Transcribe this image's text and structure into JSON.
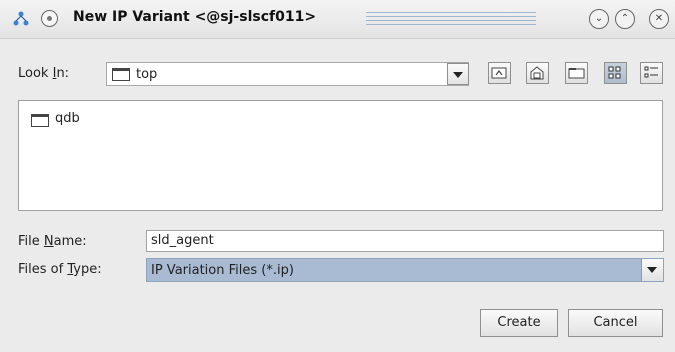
{
  "window": {
    "title": "New IP Variant <@sj-slscf011>",
    "controls": [
      "minimize-icon",
      "maximize-icon",
      "close-icon"
    ]
  },
  "look_in": {
    "label_prefix": "Look ",
    "label_underline": "I",
    "label_suffix": "n:",
    "value": "top",
    "toolbar": [
      "up-folder-icon",
      "home-icon",
      "new-folder-icon",
      "list-view-icon",
      "details-view-icon"
    ]
  },
  "file_list": {
    "items": [
      {
        "name": "qdb",
        "type": "folder"
      }
    ]
  },
  "file_name": {
    "label_prefix": "File ",
    "label_underline": "N",
    "label_suffix": "ame:",
    "value": "sld_agent"
  },
  "file_type": {
    "label_prefix": "Files of ",
    "label_underline": "T",
    "label_suffix": "ype:",
    "value": "IP Variation Files (*.ip)"
  },
  "buttons": {
    "create": "Create",
    "cancel": "Cancel"
  },
  "colors": {
    "selected_type_bg": "#a8bbd3"
  }
}
